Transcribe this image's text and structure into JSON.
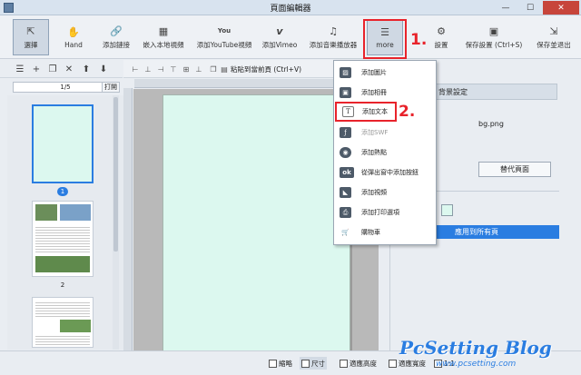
{
  "window": {
    "title": "頁面編輯器",
    "minimize": "—",
    "maximize": "☐",
    "close": "✕"
  },
  "toolbar": {
    "items": [
      {
        "label": "選擇",
        "icon": "cursor-icon"
      },
      {
        "label": "Hand",
        "icon": "hand-icon"
      },
      {
        "label": "添加鏈接",
        "icon": "link-icon"
      },
      {
        "label": "嵌入本地視頻",
        "icon": "film-icon"
      },
      {
        "label": "添加YouTube視頻",
        "icon": "youtube-icon"
      },
      {
        "label": "添加Vimeo",
        "icon": "vimeo-icon"
      },
      {
        "label": "添加音樂播放器",
        "icon": "music-icon"
      },
      {
        "label": "more",
        "icon": "more-icon"
      },
      {
        "label": "設置",
        "icon": "gear-icon"
      },
      {
        "label": "保存設置 (Ctrl+S)",
        "icon": "save-icon"
      },
      {
        "label": "保存並退出",
        "icon": "save-exit-icon"
      }
    ]
  },
  "annotations": {
    "step1": "1.",
    "step2": "2."
  },
  "left_panel": {
    "pager": "1/5",
    "print_label": "打開",
    "thumb_labels": [
      "1",
      "2"
    ]
  },
  "canvas_toolbar": {
    "paste_label": "粘貼到當前頁 (Ctrl+V)"
  },
  "right_panel": {
    "header": "背景設定",
    "bg_file": "bg.png",
    "replace_button": "替代頁面",
    "apply_button": "應用到所有頁"
  },
  "more_menu": {
    "items": [
      {
        "label": "添加圖片",
        "icon": "image-icon"
      },
      {
        "label": "添加相冊",
        "icon": "album-icon"
      },
      {
        "label": "添加文本",
        "icon": "text-icon"
      },
      {
        "label": "添加SWF",
        "icon": "swf-icon"
      },
      {
        "label": "添加熱點",
        "icon": "hotspot-icon"
      },
      {
        "label": "從彈出窗中添加按鈕",
        "icon": "ok-icon"
      },
      {
        "label": "添加視頻",
        "icon": "shape-icon"
      },
      {
        "label": "添加打印選項",
        "icon": "print-icon"
      },
      {
        "label": "購物車",
        "icon": "cart-icon"
      }
    ]
  },
  "status_bar": {
    "thumbnail_label": "縮略",
    "actual_label": "尺寸",
    "fit_height_label": "適應高度",
    "fit_width_label": "適應寬度",
    "zoom": "1:1"
  },
  "watermark": {
    "text": "PcSetting Blog",
    "url": "www.pcsetting.com"
  },
  "colors": {
    "accent": "#2a7de1",
    "annotation": "#e8232b",
    "page_bg": "#dcf8ef"
  }
}
